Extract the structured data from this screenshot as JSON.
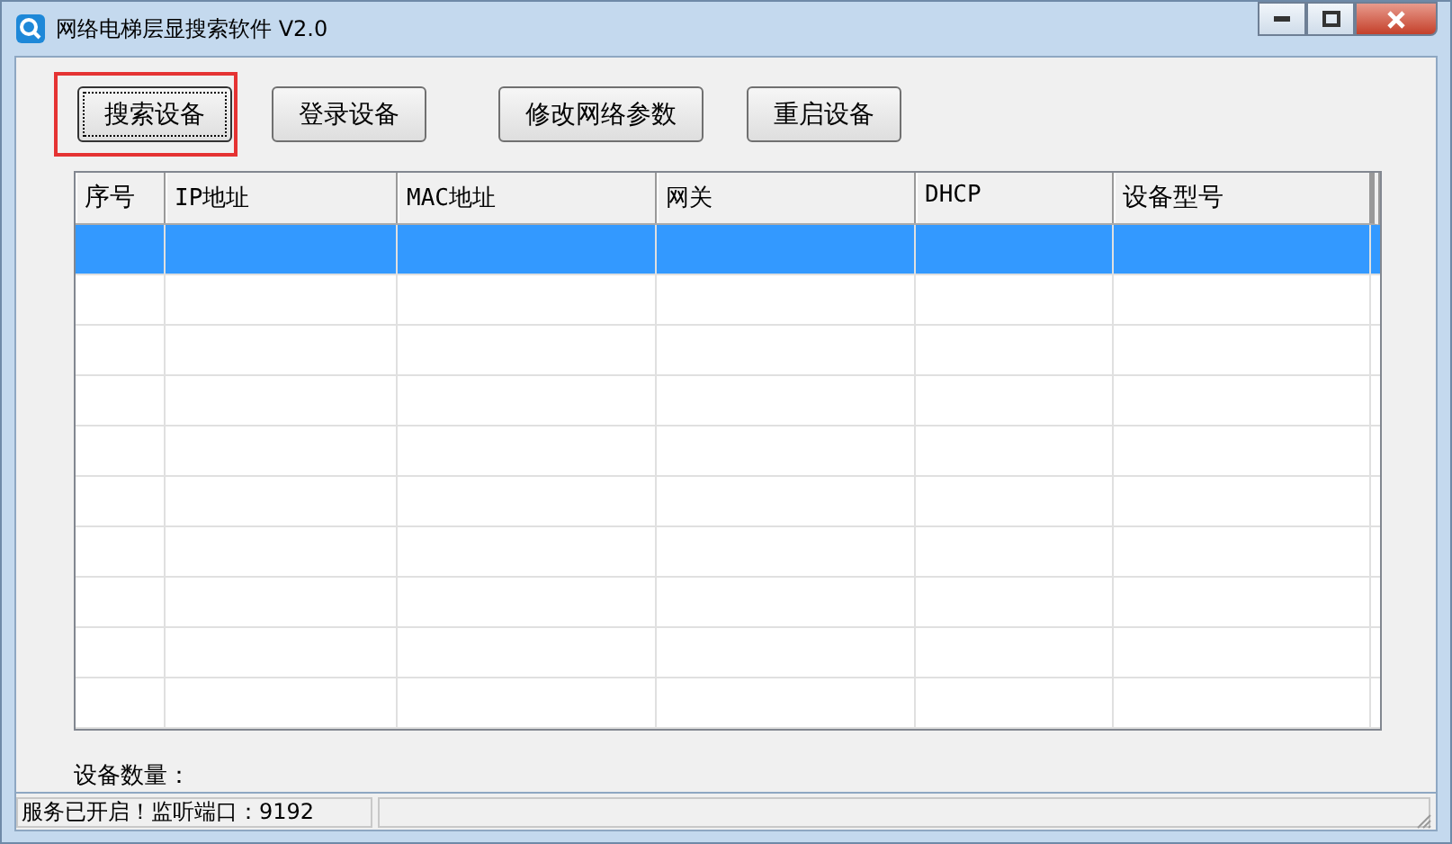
{
  "window": {
    "title": "网络电梯层显搜索软件 V2.0"
  },
  "buttons": [
    {
      "label": "搜索设备",
      "highlighted": true
    },
    {
      "label": "登录设备",
      "highlighted": false
    },
    {
      "label": "修改网络参数",
      "highlighted": false
    },
    {
      "label": "重启设备",
      "highlighted": false
    }
  ],
  "table": {
    "columns": [
      "序号",
      "IP地址",
      "MAC地址",
      "网关",
      "DHCP",
      "设备型号"
    ],
    "rows": [
      {
        "selected": true
      },
      {
        "selected": false
      },
      {
        "selected": false
      },
      {
        "selected": false
      },
      {
        "selected": false
      },
      {
        "selected": false
      },
      {
        "selected": false
      },
      {
        "selected": false
      },
      {
        "selected": false
      },
      {
        "selected": false
      }
    ]
  },
  "device_count_label": "设备数量：",
  "status_bar": {
    "panels": [
      "服务已开启！监听端口：9192"
    ]
  }
}
